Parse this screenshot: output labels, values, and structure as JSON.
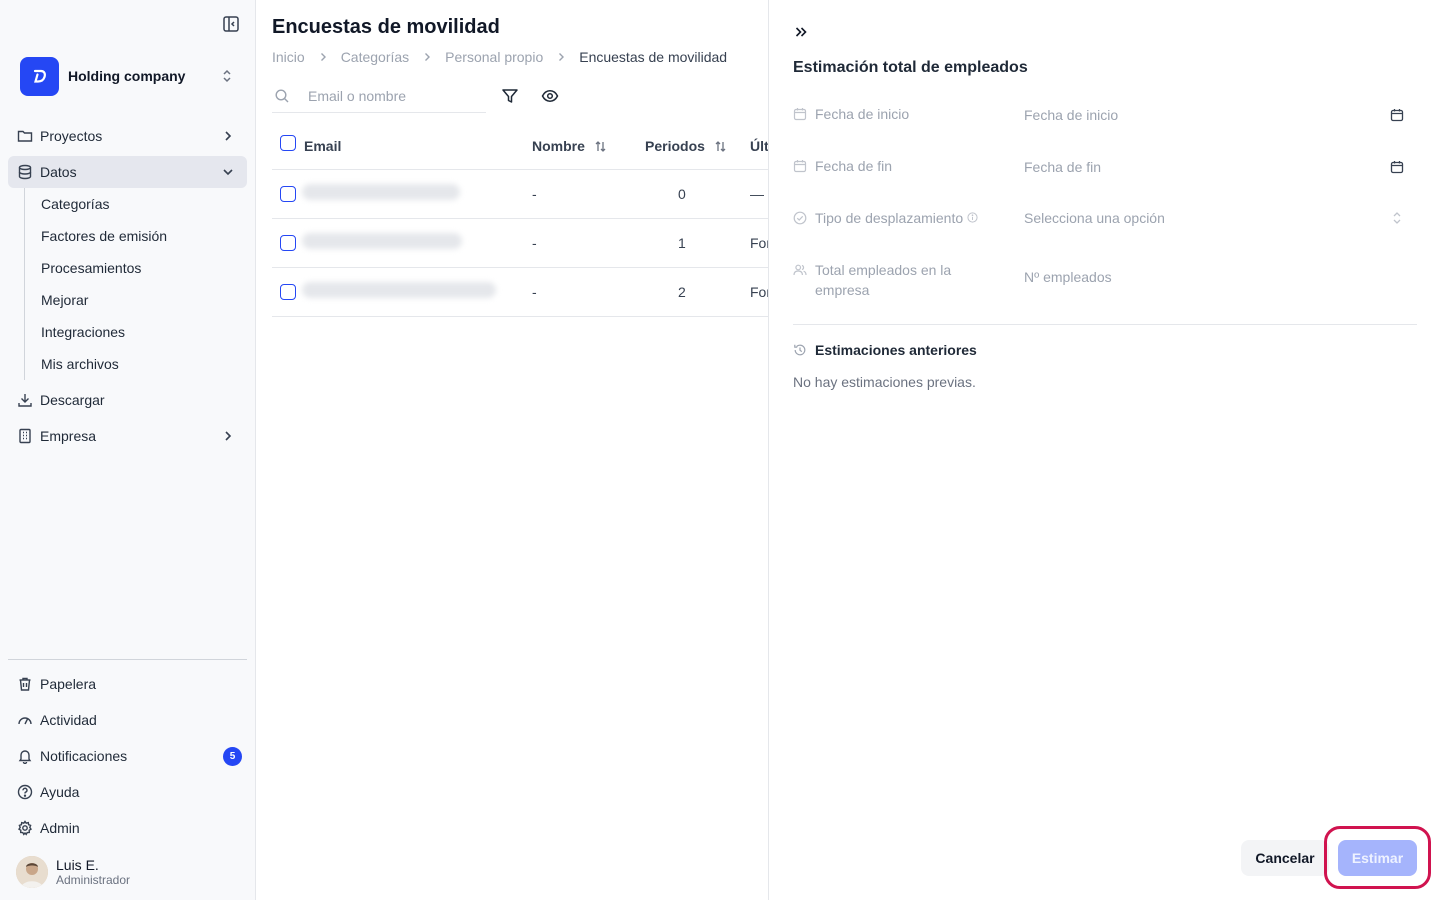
{
  "sidebar": {
    "company_name": "Holding company",
    "nav": {
      "proyectos": "Proyectos",
      "datos": "Datos",
      "descargar": "Descargar",
      "empresa": "Empresa"
    },
    "sub_items": [
      "Categorías",
      "Factores de emisión",
      "Procesamientos",
      "Mejorar",
      "Integraciones",
      "Mis archivos"
    ],
    "bottom": {
      "papelera": "Papelera",
      "actividad": "Actividad",
      "notificaciones": "Notificaciones",
      "notifications_count": "5",
      "ayuda": "Ayuda",
      "admin": "Admin"
    },
    "user": {
      "name": "Luis E.",
      "role": "Administrador"
    }
  },
  "main": {
    "title": "Encuestas de movilidad",
    "breadcrumb": [
      "Inicio",
      "Categorías",
      "Personal propio",
      "Encuestas de movilidad"
    ],
    "search_placeholder": "Email o nombre",
    "columns": {
      "email": "Email",
      "nombre": "Nombre",
      "periodos": "Periodos",
      "ultima": "Últ"
    },
    "rows": [
      {
        "nombre": "-",
        "periodos": "0",
        "ultima": "—"
      },
      {
        "nombre": "-",
        "periodos": "1",
        "ultima": "For"
      },
      {
        "nombre": "-",
        "periodos": "2",
        "ultima": "For"
      }
    ]
  },
  "panel": {
    "title": "Estimación total de empleados",
    "fields": {
      "start_label": "Fecha de inicio",
      "start_placeholder": "Fecha de inicio",
      "end_label": "Fecha de fin",
      "end_placeholder": "Fecha de fin",
      "type_label": "Tipo de desplazamiento",
      "type_placeholder": "Selecciona una opción",
      "total_label": "Total empleados en la empresa",
      "total_placeholder": "Nº empleados"
    },
    "previous_title": "Estimaciones anteriores",
    "previous_empty": "No hay estimaciones previas.",
    "cancel_label": "Cancelar",
    "estimate_label": "Estimar"
  },
  "colors": {
    "accent": "#2547f4",
    "highlight": "#d0134f",
    "estimate_disabled": "#a5b4fc"
  }
}
